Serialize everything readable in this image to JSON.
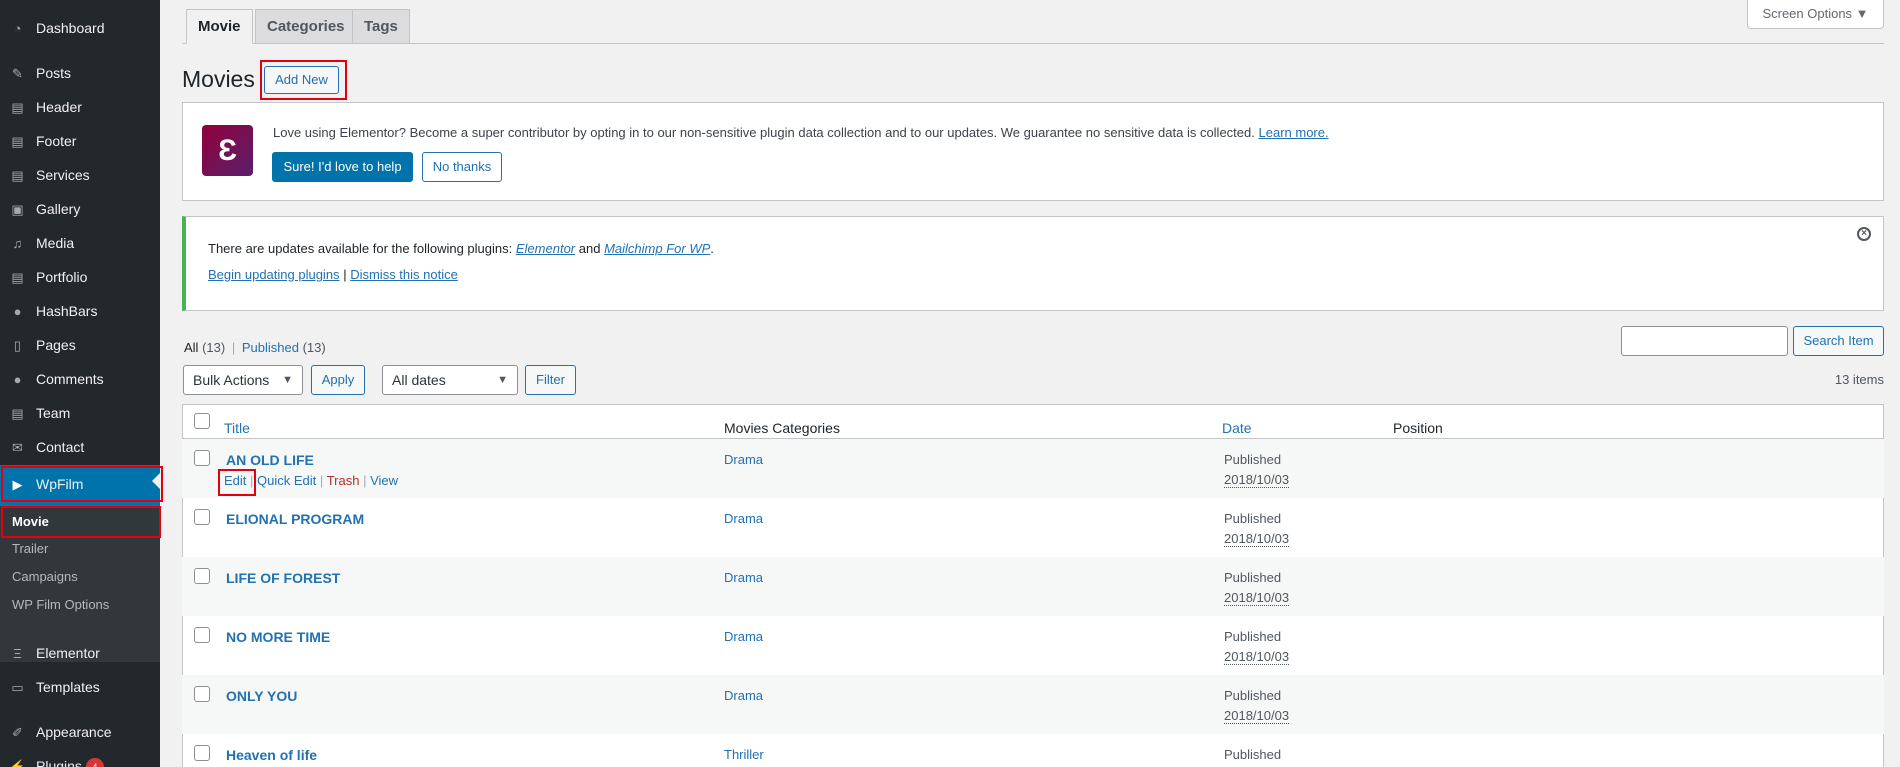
{
  "sidebar": {
    "items": [
      {
        "label": "Dashboard",
        "icon": "dashboard-icon"
      },
      {
        "label": "Posts",
        "icon": "pin-icon"
      },
      {
        "label": "Header",
        "icon": "page-icon"
      },
      {
        "label": "Footer",
        "icon": "page-icon"
      },
      {
        "label": "Services",
        "icon": "page-icon"
      },
      {
        "label": "Gallery",
        "icon": "gallery-icon"
      },
      {
        "label": "Media",
        "icon": "media-icon"
      },
      {
        "label": "Portfolio",
        "icon": "portfolio-icon"
      },
      {
        "label": "HashBars",
        "icon": "comment-icon"
      },
      {
        "label": "Pages",
        "icon": "pages-icon"
      },
      {
        "label": "Comments",
        "icon": "comment-icon"
      },
      {
        "label": "Team",
        "icon": "team-icon"
      },
      {
        "label": "Contact",
        "icon": "mail-icon"
      },
      {
        "label": "WpFilm",
        "icon": "video-icon"
      },
      {
        "label": "Elementor",
        "icon": "elementor-icon"
      },
      {
        "label": "Templates",
        "icon": "folder-icon"
      },
      {
        "label": "Appearance",
        "icon": "brush-icon"
      },
      {
        "label": "Plugins",
        "icon": "plugin-icon",
        "badge": "4"
      }
    ],
    "submenu": [
      "Movie",
      "Trailer",
      "Campaigns",
      "WP Film Options"
    ]
  },
  "tabs": [
    "Movie",
    "Categories",
    "Tags"
  ],
  "screen_options": "Screen Options ▼",
  "page_title": "Movies",
  "add_new": "Add New",
  "elementor_notice": {
    "text": "Love using Elementor? Become a super contributor by opting in to our non-sensitive plugin data collection and to our updates. We guarantee no sensitive data is collected.",
    "learn_more": "Learn more.",
    "yes": "Sure! I'd love to help",
    "no": "No thanks"
  },
  "update_notice": {
    "prefix": "There are updates available for the following plugins:",
    "plugin1": "Elementor",
    "and": "and",
    "plugin2": "Mailchimp For WP",
    "period": ".",
    "begin": "Begin updating plugins",
    "sep": "|",
    "dismiss": "Dismiss this notice"
  },
  "filters": {
    "all": "All",
    "all_count": "(13)",
    "sep": "|",
    "published": "Published",
    "published_count": "(13)",
    "search_value": "",
    "search_button": "Search Item",
    "bulk_actions": "Bulk Actions",
    "apply": "Apply",
    "dates": "All dates",
    "filter": "Filter",
    "items_count": "13 items"
  },
  "table": {
    "headers": [
      "Title",
      "Movies Categories",
      "Date",
      "Position"
    ],
    "row_actions": {
      "edit": "Edit",
      "quick_edit": "Quick Edit",
      "trash": "Trash",
      "view": "View",
      "sep": "|"
    },
    "rows": [
      {
        "title": "AN OLD LIFE",
        "category": "Drama",
        "status": "Published",
        "date": "2018/10/03"
      },
      {
        "title": "ELIONAL PROGRAM",
        "category": "Drama",
        "status": "Published",
        "date": "2018/10/03"
      },
      {
        "title": "LIFE OF FOREST",
        "category": "Drama",
        "status": "Published",
        "date": "2018/10/03"
      },
      {
        "title": "NO MORE TIME",
        "category": "Drama",
        "status": "Published",
        "date": "2018/10/03"
      },
      {
        "title": "ONLY YOU",
        "category": "Drama",
        "status": "Published",
        "date": "2018/10/03"
      },
      {
        "title": "Heaven of life",
        "category": "Thriller",
        "status": "Published",
        "date": ""
      }
    ]
  },
  "colors": {
    "sidebar": "#23282d",
    "accent": "#0073aa",
    "highlight_box": "#e3000f",
    "elementor_brand": "#92003b",
    "notice_border": "#46b450"
  }
}
